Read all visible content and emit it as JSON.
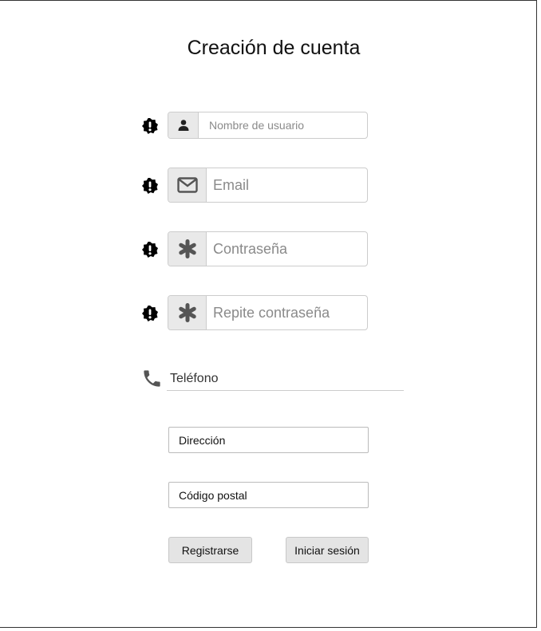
{
  "title": "Creación de cuenta",
  "form": {
    "username": {
      "placeholder": "Nombre de usuario",
      "icon": "user-icon"
    },
    "email": {
      "placeholder": "Email",
      "icon": "envelope-icon"
    },
    "password": {
      "placeholder": "Contraseña",
      "icon": "asterisk-icon"
    },
    "password_repeat": {
      "placeholder": "Repite contraseña",
      "icon": "asterisk-icon"
    },
    "phone": {
      "label": "Teléfono",
      "icon": "phone-icon"
    },
    "address": {
      "label": "Dirección"
    },
    "postal_code": {
      "label": "Código postal"
    }
  },
  "buttons": {
    "register": "Registrarse",
    "login": "Iniciar sesión"
  },
  "colors": {
    "addon_bg": "#e9e9e9",
    "border": "#cccccc",
    "button_bg": "#e4e4e4",
    "placeholder": "#8a8a8a"
  }
}
